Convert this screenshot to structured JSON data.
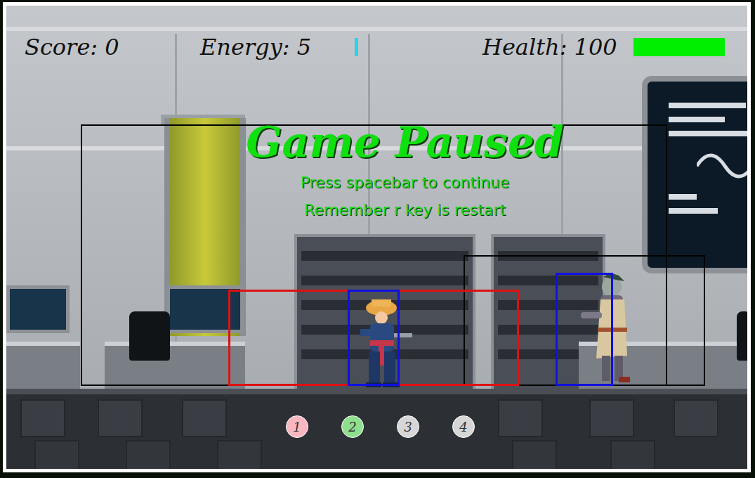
{
  "hud": {
    "score": "Score: 0",
    "energy": {
      "label": "Energy: 5",
      "level": 0.05
    },
    "health": {
      "label": "Health: 100",
      "level": 1
    }
  },
  "pause": {
    "title": "Game Paused",
    "lines": [
      "Press spacebar to continue",
      "Remember r key is restart"
    ]
  },
  "slots": [
    {
      "label": "1",
      "color": "#f9b7c0"
    },
    {
      "label": "2",
      "color": "#8ee08e"
    },
    {
      "label": "3",
      "color": "#d6d6d6"
    },
    {
      "label": "4",
      "color": "#d6d6d6"
    }
  ]
}
